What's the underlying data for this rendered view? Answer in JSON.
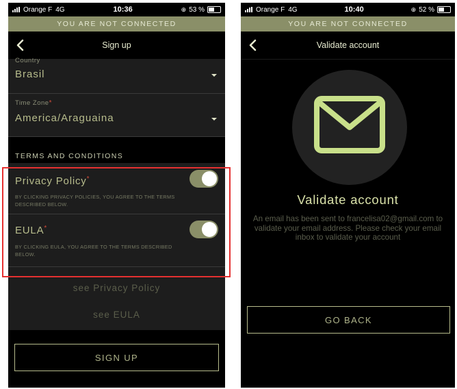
{
  "left_screen": {
    "status": {
      "carrier": "Orange F",
      "network": "4G",
      "time": "10:36",
      "battery": "53 %",
      "battery_level": 0.53
    },
    "banner": "YOU ARE NOT CONNECTED",
    "title": "Sign up",
    "country": {
      "label": "Country",
      "value": "Brasil"
    },
    "timezone": {
      "label": "Time Zone",
      "required_mark": "*",
      "value": "America/Araguaina"
    },
    "terms_title": "TERMS AND CONDITIONS",
    "privacy": {
      "label": "Privacy Policy",
      "required_mark": "*",
      "description": "BY CLICKING PRIVACY POLICIES, YOU AGREE TO THE TERMS DESCRIBED BELOW.",
      "on": true
    },
    "eula": {
      "label": "EULA",
      "required_mark": "*",
      "description": "BY CLICKING EULA, YOU AGREE TO THE TERMS DESCRIBED BELOW.",
      "on": true
    },
    "see_privacy": "see Privacy Policy",
    "see_eula": "see EULA",
    "sign_up_button": "SIGN UP"
  },
  "right_screen": {
    "status": {
      "carrier": "Orange F",
      "network": "4G",
      "time": "10:40",
      "battery": "52 %",
      "battery_level": 0.52
    },
    "banner": "YOU ARE NOT CONNECTED",
    "title": "Validate account",
    "icon": "envelope-icon",
    "heading": "Validate account",
    "message": "An email has been sent to francelisa02@gmail.com to validate your email address. Please check your email inbox to validate your account",
    "go_back_button": "GO BACK"
  },
  "colors": {
    "accent": "#c9e08a",
    "banner": "#8a8f68",
    "highlight": "#e53030",
    "required": "#d24b3a"
  }
}
